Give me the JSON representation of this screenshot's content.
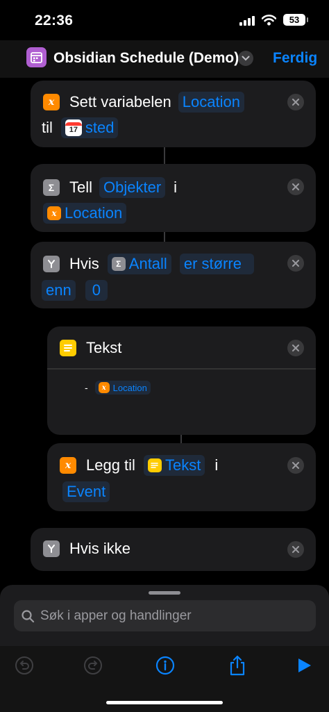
{
  "status": {
    "time": "22:36",
    "battery": "53"
  },
  "header": {
    "title": "Obsidian Schedule (Demo)",
    "done_label": "Ferdig"
  },
  "actions": [
    {
      "id": "set-variable",
      "label": "Sett variabelen",
      "variable": "Location",
      "connector": "til",
      "value": "sted"
    },
    {
      "id": "count",
      "label": "Tell",
      "type": "Objekter",
      "connector": "i",
      "source": "Location"
    },
    {
      "id": "if",
      "label": "Hvis",
      "operand": "Antall",
      "condition_part1": "er større",
      "condition_part2": "enn",
      "value": "0"
    },
    {
      "id": "text",
      "label": "Tekst",
      "content_prefix": "-",
      "content_variable": "Location"
    },
    {
      "id": "add-to",
      "label": "Legg til",
      "item": "Tekst",
      "connector": "i",
      "target": "Event"
    },
    {
      "id": "otherwise",
      "label": "Hvis ikke"
    }
  ],
  "search": {
    "placeholder": "Søk i apper og handlinger"
  },
  "icons": {
    "variable": "variable-x-icon",
    "calendar": "calendar-icon",
    "count": "sigma-icon",
    "if": "branch-icon",
    "text": "text-note-icon",
    "close": "close-icon"
  },
  "colors": {
    "accent": "#0a84ff",
    "variable": "#ff8a00",
    "text": "#ffcc00",
    "card": "#1c1c1e"
  }
}
